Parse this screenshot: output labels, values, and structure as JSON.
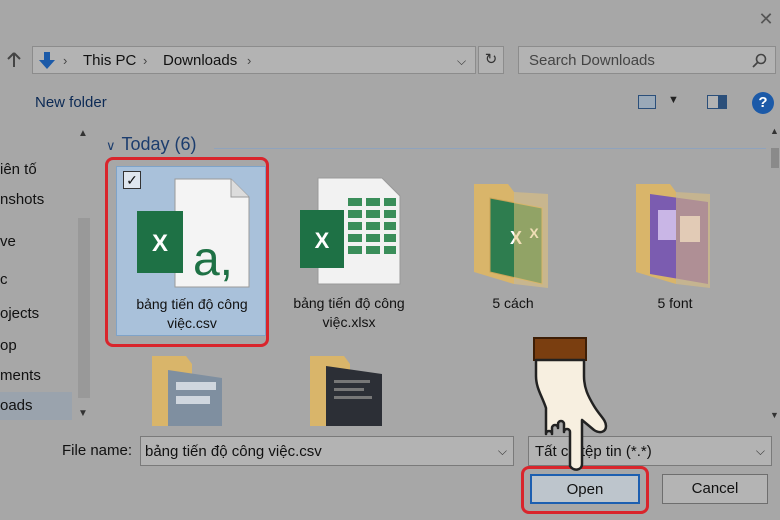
{
  "window": {
    "close_glyph": "✕"
  },
  "address_bar": {
    "up_icon": "up-arrow-icon",
    "location_icon": "downloads-arrow-icon",
    "breadcrumbs": [
      "This PC",
      "Downloads"
    ],
    "refresh_icon": "refresh-icon",
    "search_placeholder": "Search Downloads"
  },
  "command_bar": {
    "new_folder_label": "New folder",
    "help_glyph": "?"
  },
  "nav": {
    "items": [
      {
        "label": "iên tố"
      },
      {
        "label": "nshots"
      },
      {
        "label": "ve"
      },
      {
        "label": "c"
      },
      {
        "label": "ojects"
      },
      {
        "label": "op"
      },
      {
        "label": "ments"
      },
      {
        "label": "oads",
        "selected": true
      }
    ]
  },
  "content": {
    "group_title": "Today (6)",
    "files": [
      {
        "name": "bảng tiến độ công việc.csv",
        "type": "csv",
        "selected": true,
        "checked": "✓"
      },
      {
        "name": "bảng tiến độ công việc.xlsx",
        "type": "xlsx"
      },
      {
        "name": "5 cách",
        "type": "folder"
      },
      {
        "name": "5 font",
        "type": "folder"
      },
      {
        "name": "",
        "type": "folder"
      },
      {
        "name": "",
        "type": "folder"
      }
    ]
  },
  "bottom": {
    "file_name_label": "File name:",
    "file_name_value": "bảng tiến độ công việc.csv",
    "file_type_value": "Tất cả tệp tin (*.*)",
    "open_label": "Open",
    "cancel_label": "Cancel"
  },
  "colors": {
    "highlight_red": "#d9252c",
    "excel_green": "#1e7145",
    "selection_blue": "#a9c1da",
    "hand_brown": "#7a3e10"
  }
}
